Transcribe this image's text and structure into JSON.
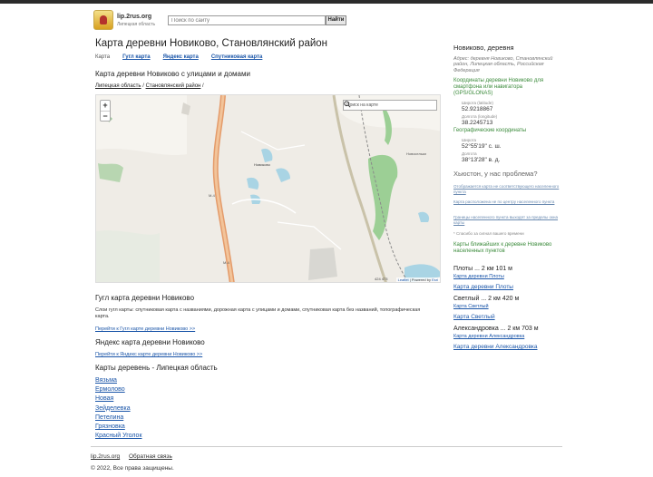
{
  "header": {
    "site_name": "lip.2rus.org",
    "site_sub": "Липецкая область",
    "search_placeholder": "Поиск по сайту",
    "search_button": "Найти"
  },
  "page": {
    "title": "Карта деревни Новиково, Становлянский район",
    "tabs": [
      "Карта",
      "Гугл карта",
      "Яндекс карта",
      "Спутниковая карта"
    ],
    "subtitle": "Карта деревни Новиково с улицами и домами",
    "breadcrumbs": [
      "Липецкая область",
      "Становлянский район"
    ]
  },
  "map": {
    "search_placeholder": "Поиск на карте",
    "zoom_in": "+",
    "zoom_out": "−",
    "attribution_leaflet": "Leaflet",
    "attribution_sep": " | Powered by ",
    "attribution_esri": "Esri",
    "scale": "424 473",
    "labels": {
      "village": "Новиково",
      "road1": "M-4",
      "road2": "M-4",
      "east_village": "Новосельки"
    }
  },
  "google_section": {
    "title": "Гугл карта деревни Новиково",
    "text": "Слои гугл карты: спутниковая карта с названиями, дорожная карта с улицами и домами, спутниковая карта без названий, топографическая карта.",
    "link": "Перейти к Гугл карте деревни Новиково >>"
  },
  "yandex_section": {
    "title": "Яндекс карта деревни Новиково",
    "link": "Перейти к Яндекс карте деревни Новиково >>"
  },
  "villages_section": {
    "title": "Карты деревень - Липецкая область",
    "items": [
      "Вязьма",
      "Ермолово",
      "Новая",
      "Зейделевка",
      "Петелина",
      "Грязновка",
      "Красный Уголок"
    ]
  },
  "sidebar": {
    "title": "Новиково, деревня",
    "address": "Адрес: деревня Новиково, Становлянский район, Липецкая область, Российская Федерация",
    "coords_title": "Координаты деревни Новиково для смартфона или навигатора (GPS/GLONAS)",
    "lat_label": "Широта (latitude)",
    "lat_value": "52.9218867",
    "lon_label": "Долгота (longitude)",
    "lon_value": "38.2245713",
    "geo_title": "Географические координаты",
    "geo_lat_label": "Широта",
    "geo_lat_value": "52°55'19\" с. ш.",
    "geo_lon_label": "Долгота",
    "geo_lon_value": "38°13'28\" в. д.",
    "problem_title": "Хьюстон, у нас проблема?",
    "problem_links": [
      "Отображается карта не соответствующего населенного пункта",
      "Карта расположена не по центру населенного пункта",
      "Границы населенного пункта выходят за пределы окна карты"
    ],
    "thanks": "* Спасибо за сигнал вашего времени",
    "nearby_title": "Карты ближайших к деревне Новиково населенных пунктов",
    "nearby": [
      {
        "name": "Плоты ... 2 км 101 м",
        "link": "Карта деревни Плоты"
      },
      {
        "name": "Светлый ... 2 км 420 м",
        "link": "Карта Светлый"
      },
      {
        "name": "Александровка ... 2 км 703 м",
        "link": "Карта деревни Александровка"
      }
    ],
    "nearby_extra_links": [
      "Карта деревни Плоты",
      "Карта Светлый",
      "Карта деревни Александровка"
    ]
  },
  "footer": {
    "links": [
      "lip.2rus.org",
      "Обратная связь"
    ],
    "copyright": "© 2022, Все права защищены."
  }
}
